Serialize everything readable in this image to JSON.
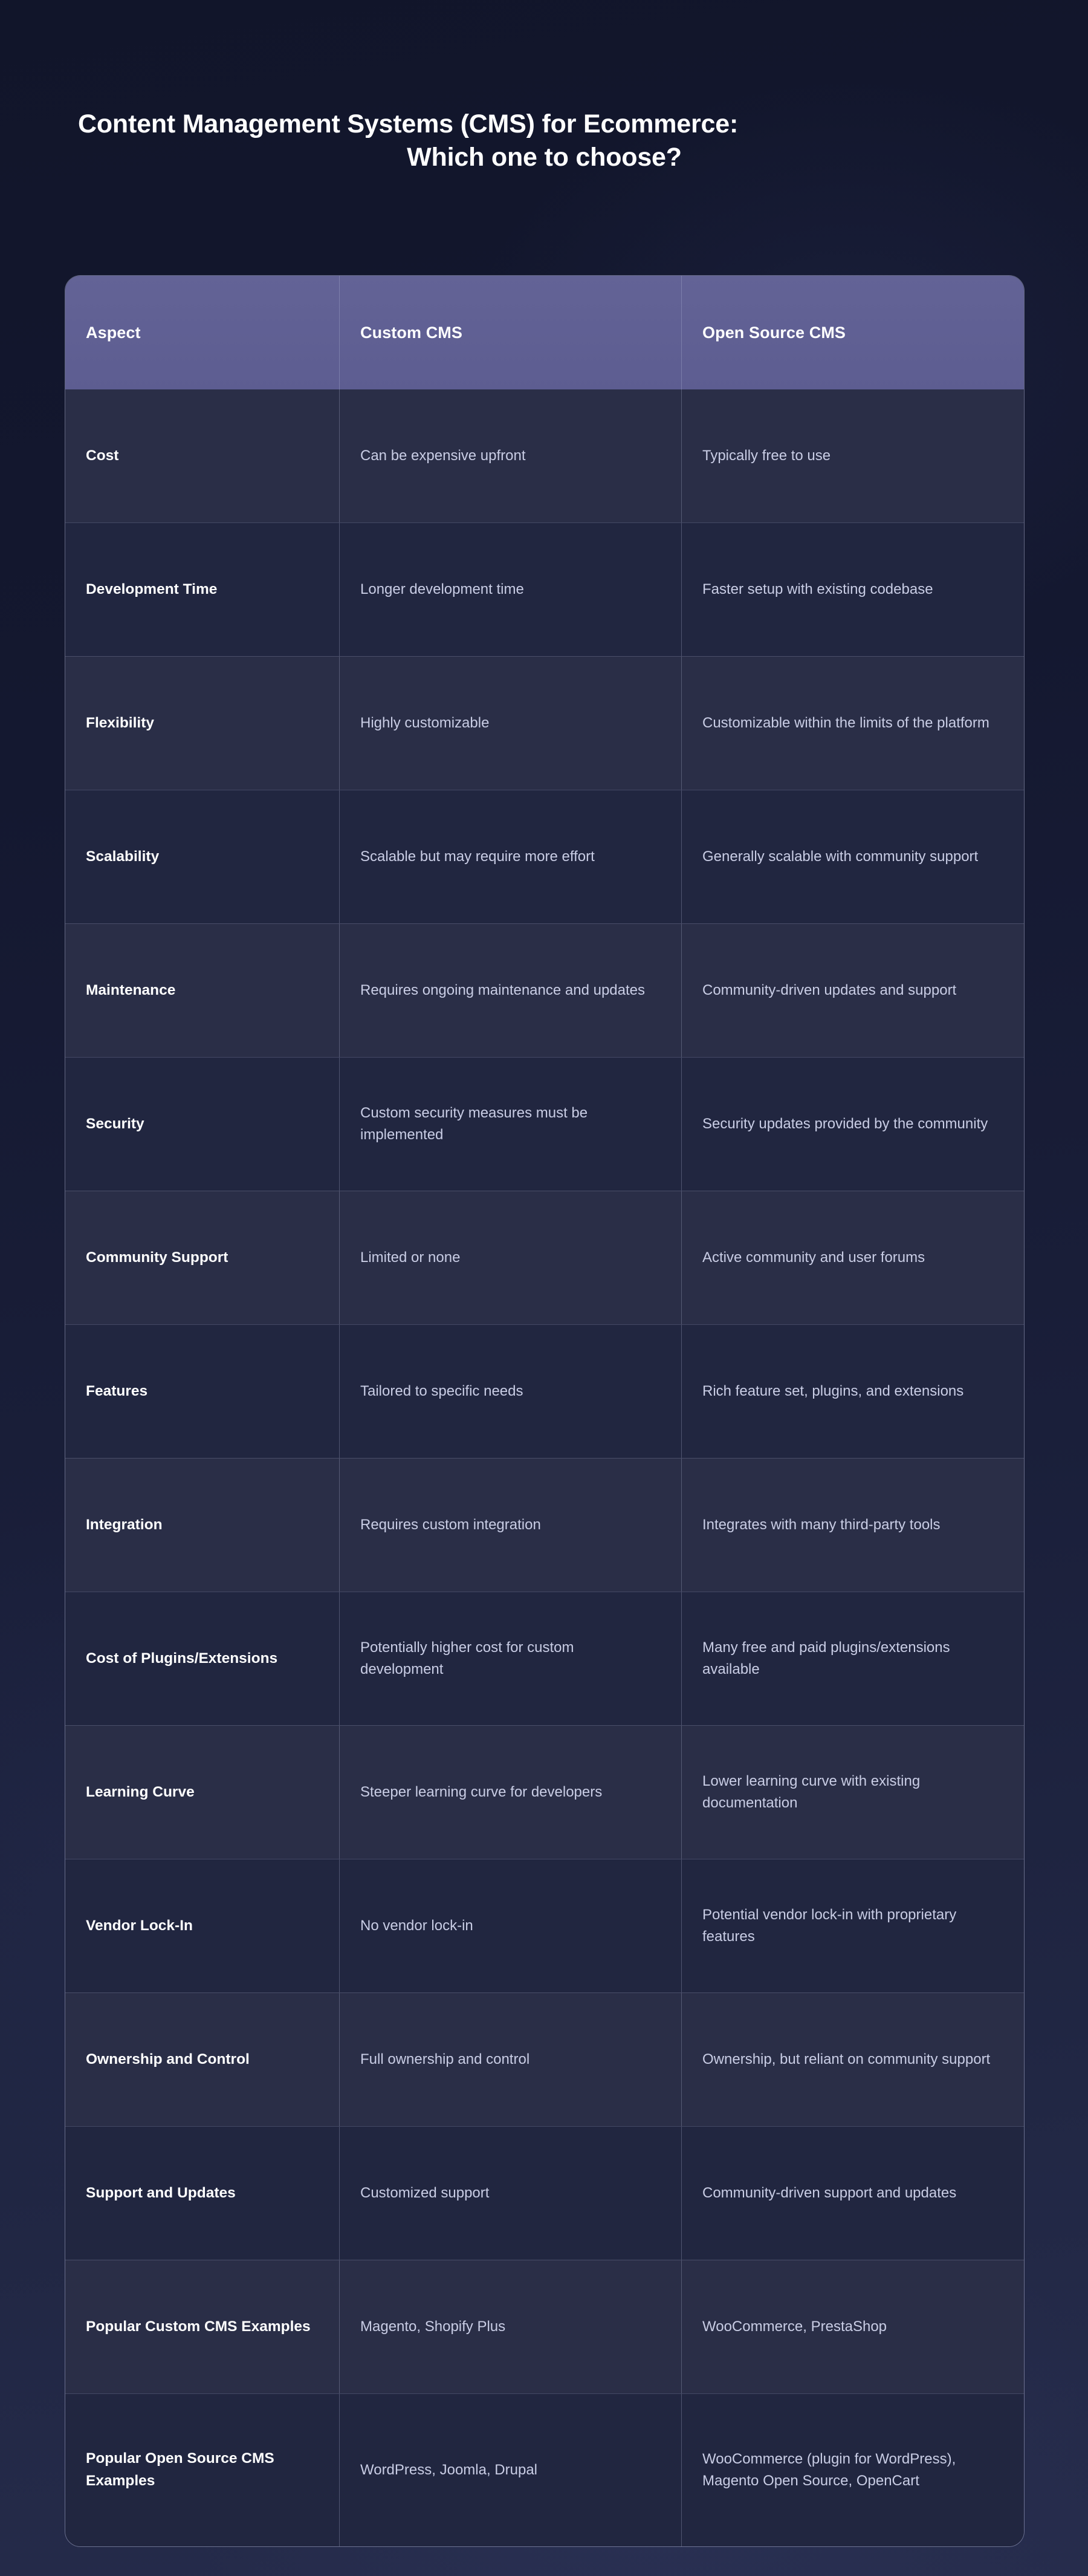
{
  "page": {
    "background_top": "#11152a",
    "background_bottom": "#262c4c"
  },
  "title": {
    "line1": "Content Management Systems (CMS) for Ecommerce:",
    "line2": "Which one to choose?"
  },
  "table": {
    "header_background": "#5f5f93",
    "row_odd_background": "#2a2e47",
    "row_even_background": "#212640",
    "body_text_color": "#c9cde5",
    "columns": [
      "Aspect",
      "Custom CMS",
      "Open Source CMS"
    ],
    "rows": [
      {
        "aspect": "Cost",
        "custom": "Can be expensive upfront",
        "open_source": "Typically free to use"
      },
      {
        "aspect": "Development Time",
        "custom": "Longer development time",
        "open_source": "Faster setup with existing codebase"
      },
      {
        "aspect": "Flexibility",
        "custom": "Highly customizable",
        "open_source": "Customizable within the limits of the platform"
      },
      {
        "aspect": "Scalability",
        "custom": "Scalable but may require more effort",
        "open_source": "Generally scalable with community support"
      },
      {
        "aspect": "Maintenance",
        "custom": "Requires ongoing maintenance and updates",
        "open_source": "Community-driven updates and support"
      },
      {
        "aspect": "Security",
        "custom": "Custom security measures must be implemented",
        "open_source": "Security updates provided by the community"
      },
      {
        "aspect": "Community Support",
        "custom": "Limited or none",
        "open_source": "Active community and user forums"
      },
      {
        "aspect": "Features",
        "custom": "Tailored to specific needs",
        "open_source": "Rich feature set, plugins, and extensions"
      },
      {
        "aspect": "Integration",
        "custom": "Requires custom integration",
        "open_source": "Integrates with many third-party tools"
      },
      {
        "aspect": "Cost of Plugins/Extensions",
        "custom": "Potentially higher cost for custom development",
        "open_source": "Many free and paid plugins/extensions available"
      },
      {
        "aspect": "Learning Curve",
        "custom": "Steeper learning curve for developers",
        "open_source": "Lower learning curve with existing documentation"
      },
      {
        "aspect": "Vendor Lock-In",
        "custom": "No vendor lock-in",
        "open_source": "Potential vendor lock-in with proprietary features"
      },
      {
        "aspect": "Ownership and Control",
        "custom": "Full ownership and control",
        "open_source": "Ownership, but reliant on community support"
      },
      {
        "aspect": "Support and Updates",
        "custom": "Customized support",
        "open_source": "Community-driven support and updates"
      },
      {
        "aspect": "Popular Custom CMS Examples",
        "custom": "Magento, Shopify Plus",
        "open_source": "WooCommerce, PrestaShop"
      },
      {
        "aspect": "Popular Open Source CMS Examples",
        "custom": "WordPress, Joomla, Drupal",
        "open_source": "WooCommerce (plugin for WordPress), Magento Open Source, OpenCart"
      }
    ]
  }
}
